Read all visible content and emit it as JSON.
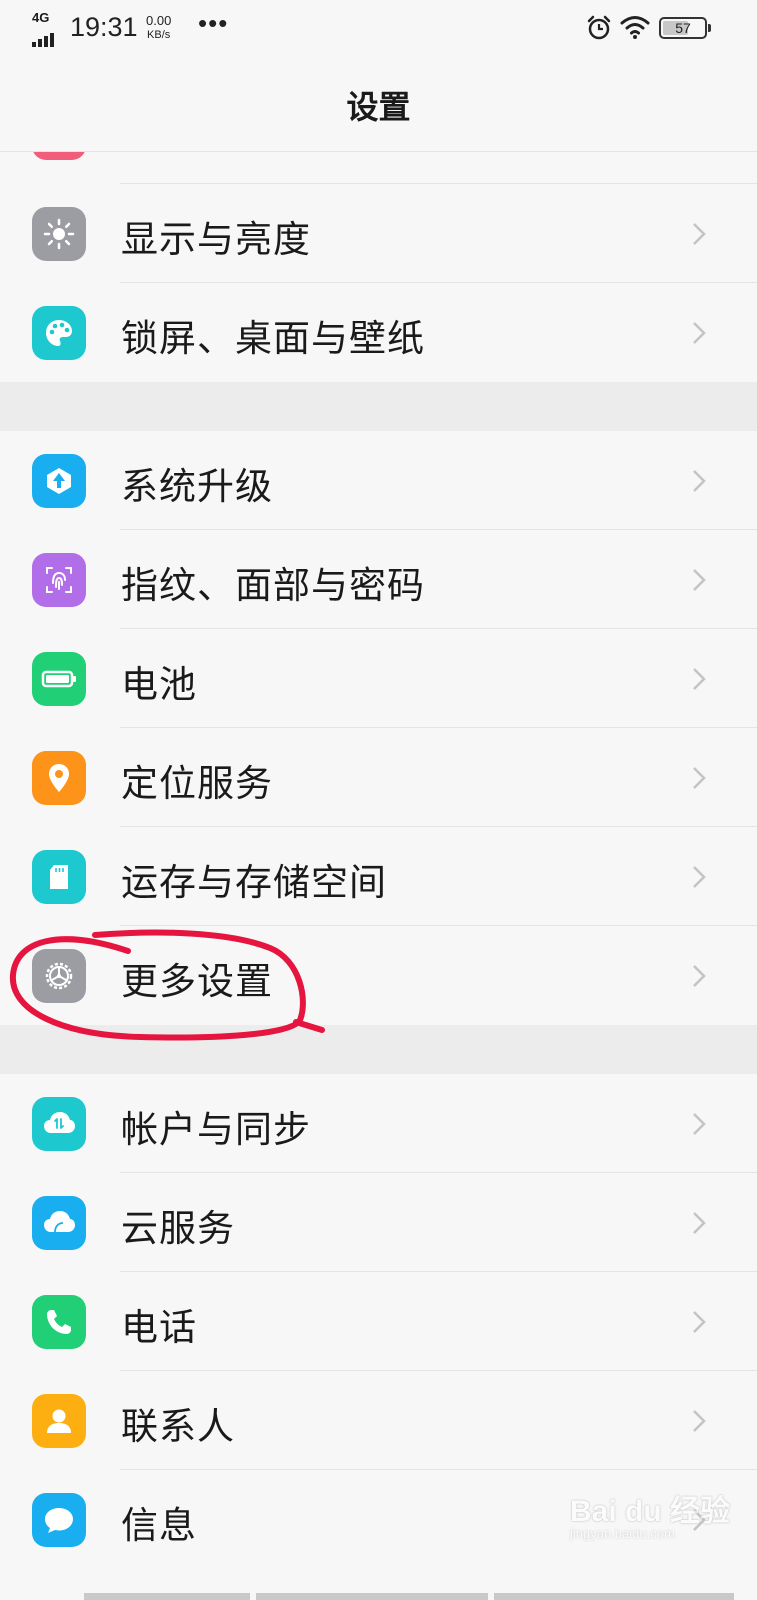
{
  "status_bar": {
    "network": "4G",
    "time": "19:31",
    "speed_value": "0.00",
    "speed_unit": "KB/s",
    "more": "•••",
    "battery_level": "57",
    "icons": [
      "signal-icon",
      "alarm-icon",
      "wifi-icon",
      "battery-icon"
    ]
  },
  "header": {
    "title": "设置"
  },
  "rows": [
    {
      "label": "显示与亮度",
      "icon": "brightness-icon",
      "color": "#9c9ca3"
    },
    {
      "label": "锁屏、桌面与壁纸",
      "icon": "palette-icon",
      "color": "#1dc8cf"
    },
    {
      "label": "系统升级",
      "icon": "upgrade-icon",
      "color": "#18aef0"
    },
    {
      "label": "指纹、面部与密码",
      "icon": "fingerprint-icon",
      "color": "#b16ee8"
    },
    {
      "label": "电池",
      "icon": "battery-icon",
      "color": "#21cf76"
    },
    {
      "label": "定位服务",
      "icon": "location-pin-icon",
      "color": "#fd9318"
    },
    {
      "label": "运存与存储空间",
      "icon": "sd-card-icon",
      "color": "#1dc8cf"
    },
    {
      "label": "更多设置",
      "icon": "gear-icon",
      "color": "#9c9ca3"
    },
    {
      "label": "帐户与同步",
      "icon": "cloud-sync-icon",
      "color": "#1dc8cf"
    },
    {
      "label": "云服务",
      "icon": "cloud-icon",
      "color": "#18aef0"
    },
    {
      "label": "电话",
      "icon": "phone-icon",
      "color": "#21cf76"
    },
    {
      "label": "联系人",
      "icon": "contact-icon",
      "color": "#fdaf12"
    },
    {
      "label": "信息",
      "icon": "message-icon",
      "color": "#18aef0"
    }
  ],
  "annotation": {
    "color": "#e5153f",
    "target": "更多设置"
  },
  "watermark": {
    "brand": "Bai du 经验",
    "url": "jingyan.baidu.com"
  }
}
